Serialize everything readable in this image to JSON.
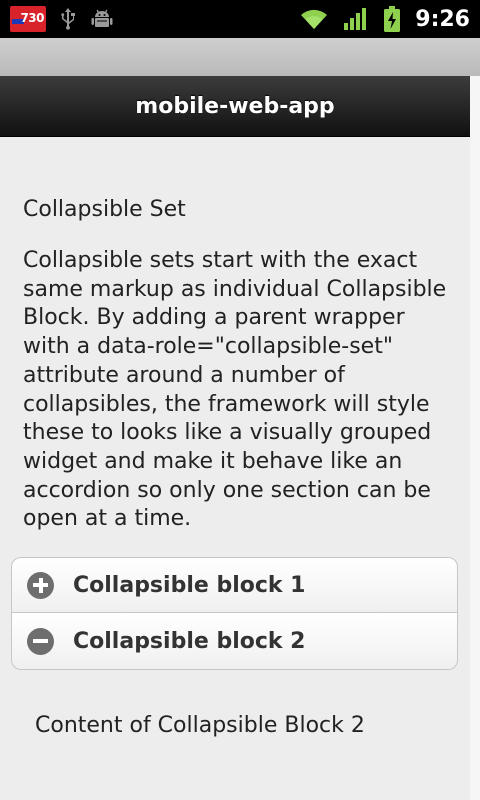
{
  "status_bar": {
    "badge_text": "730",
    "time": "9:26",
    "icons": [
      "usb-icon",
      "android-debug-icon",
      "wifi-icon",
      "signal-icon",
      "battery-charging-icon"
    ],
    "colors": {
      "badge": "#d8232a",
      "badge_stripe": "#1c3ab8",
      "accent_green": "#8fd14f"
    }
  },
  "header": {
    "title": "mobile-web-app"
  },
  "main": {
    "section_title": "Collapsible Set",
    "description": "Collapsible sets start with the exact same markup as individual Collapsible Block. By adding a parent wrapper with a data-role=\"collapsible-set\" attribute around a number of collapsibles, the framework will style these to looks like a visually grouped widget and make it behave like an accordion so only one section can be open at a time.",
    "collapsibles": [
      {
        "label": "Collapsible block 1",
        "state": "collapsed",
        "icon": "plus-icon"
      },
      {
        "label": "Collapsible block 2",
        "state": "expanded",
        "icon": "minus-icon"
      }
    ],
    "expanded_content": "Content of Collapsible Block 2"
  }
}
